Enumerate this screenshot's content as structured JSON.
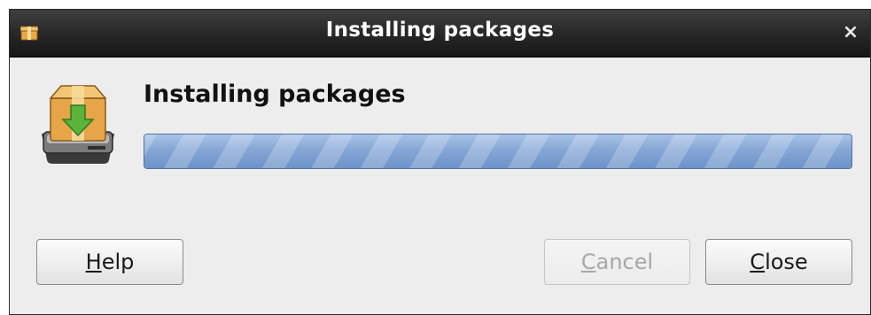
{
  "window": {
    "title": "Installing packages",
    "close_glyph": "×",
    "app_icon": "package-icon"
  },
  "main": {
    "icon": "package-install-icon",
    "heading": "Installing packages",
    "progress": {
      "state": "indeterminate",
      "fill_color": "#86a7d6"
    }
  },
  "buttons": {
    "help": {
      "mnemonic": "H",
      "rest": "elp",
      "enabled": true
    },
    "cancel": {
      "mnemonic": "C",
      "rest": "ancel",
      "enabled": false
    },
    "close": {
      "mnemonic": "C",
      "rest": "lose",
      "enabled": true
    }
  }
}
